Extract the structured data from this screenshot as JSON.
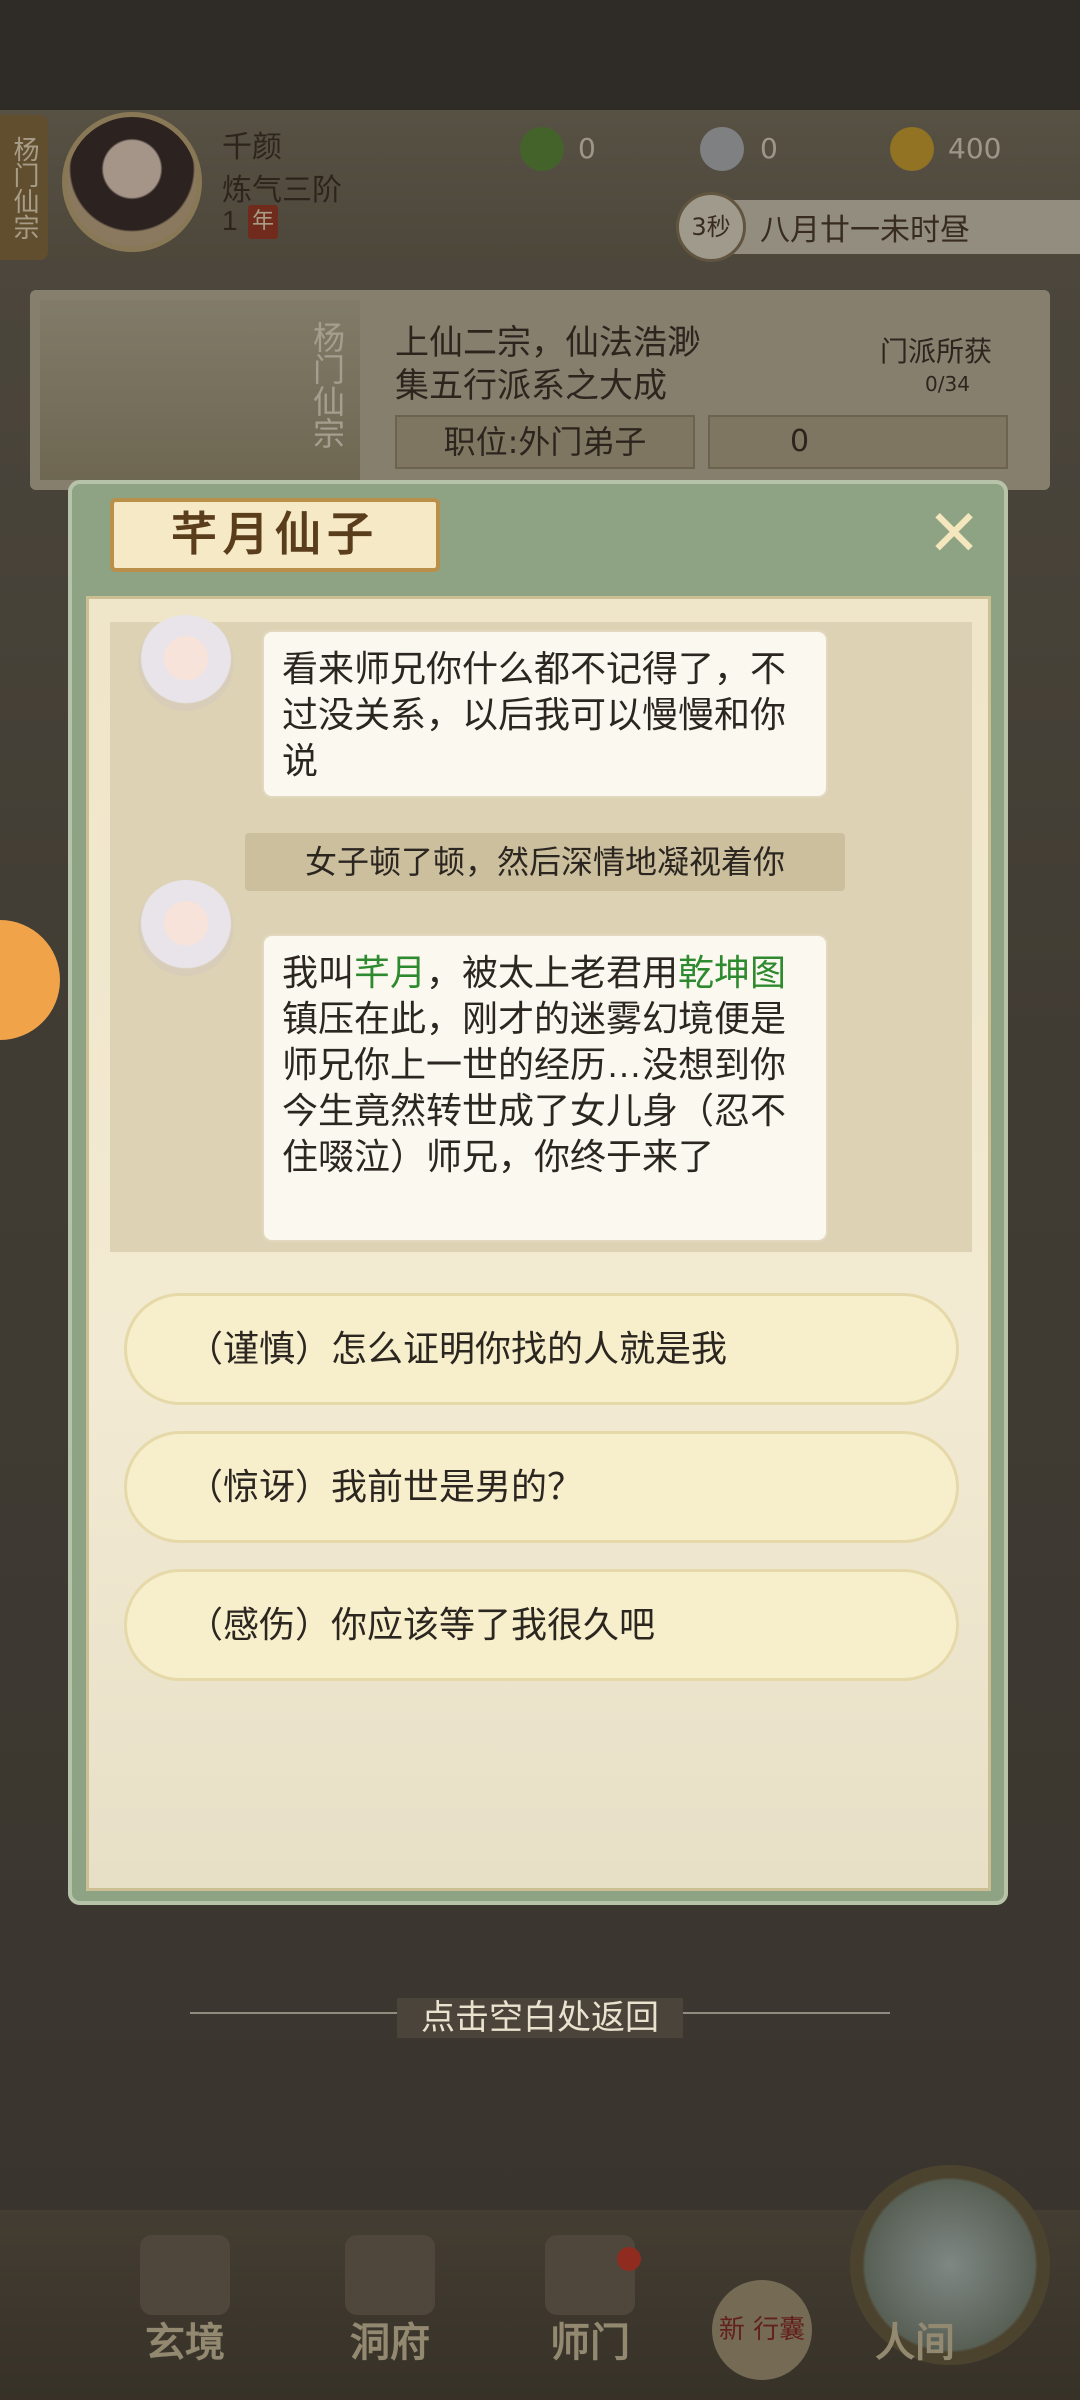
{
  "player": {
    "sect_tab": "杨门仙宗",
    "name": "千颜",
    "rank": "炼气三阶",
    "year_num": "1",
    "year_unit": "年"
  },
  "resources": [
    {
      "icon": "leaf-icon",
      "value": "0"
    },
    {
      "icon": "coin-icon",
      "value": "0"
    },
    {
      "icon": "gold-ingot-icon",
      "value": "400"
    }
  ],
  "time": {
    "countdown": "3秒",
    "date": "八月廿一未时昼"
  },
  "sect": {
    "name": "杨门仙宗",
    "motto_line1": "上仙二宗，仙法浩渺",
    "motto_line2": "集五行派系之大成",
    "position": "职位:外门弟子",
    "coins": "0",
    "harvest_label": "门派所获",
    "harvest_count": "0/34"
  },
  "dialog": {
    "title": "芊月仙子",
    "close_icon": "close-icon",
    "messages": [
      {
        "type": "npc",
        "text": "看来师兄你什么都不记得了，不过没关系，以后我可以慢慢和你说"
      },
      {
        "type": "narration",
        "text": "女子顿了顿，然后深情地凝视着你"
      },
      {
        "type": "npc",
        "parts": [
          "我叫",
          "芊月",
          "，被太上老君用",
          "乾坤图",
          "镇压在此，刚才的迷雾幻境便是师兄你上一世的经历…没想到你今生竟然转世成了女儿身（忍不住啜泣）师兄，你终于来了"
        ]
      }
    ],
    "options": [
      "（谨慎）怎么证明你找的人就是我",
      "（惊讶）我前世是男的？",
      "（感伤）你应该等了我很久吧"
    ]
  },
  "hint": "点击空白处返回",
  "nav": {
    "items": [
      "玄境",
      "洞府",
      "师门",
      "人间"
    ],
    "new_badge": "新 行囊"
  },
  "colors": {
    "highlight": "#2e8a2e",
    "dialog_frame": "#8ea384"
  }
}
